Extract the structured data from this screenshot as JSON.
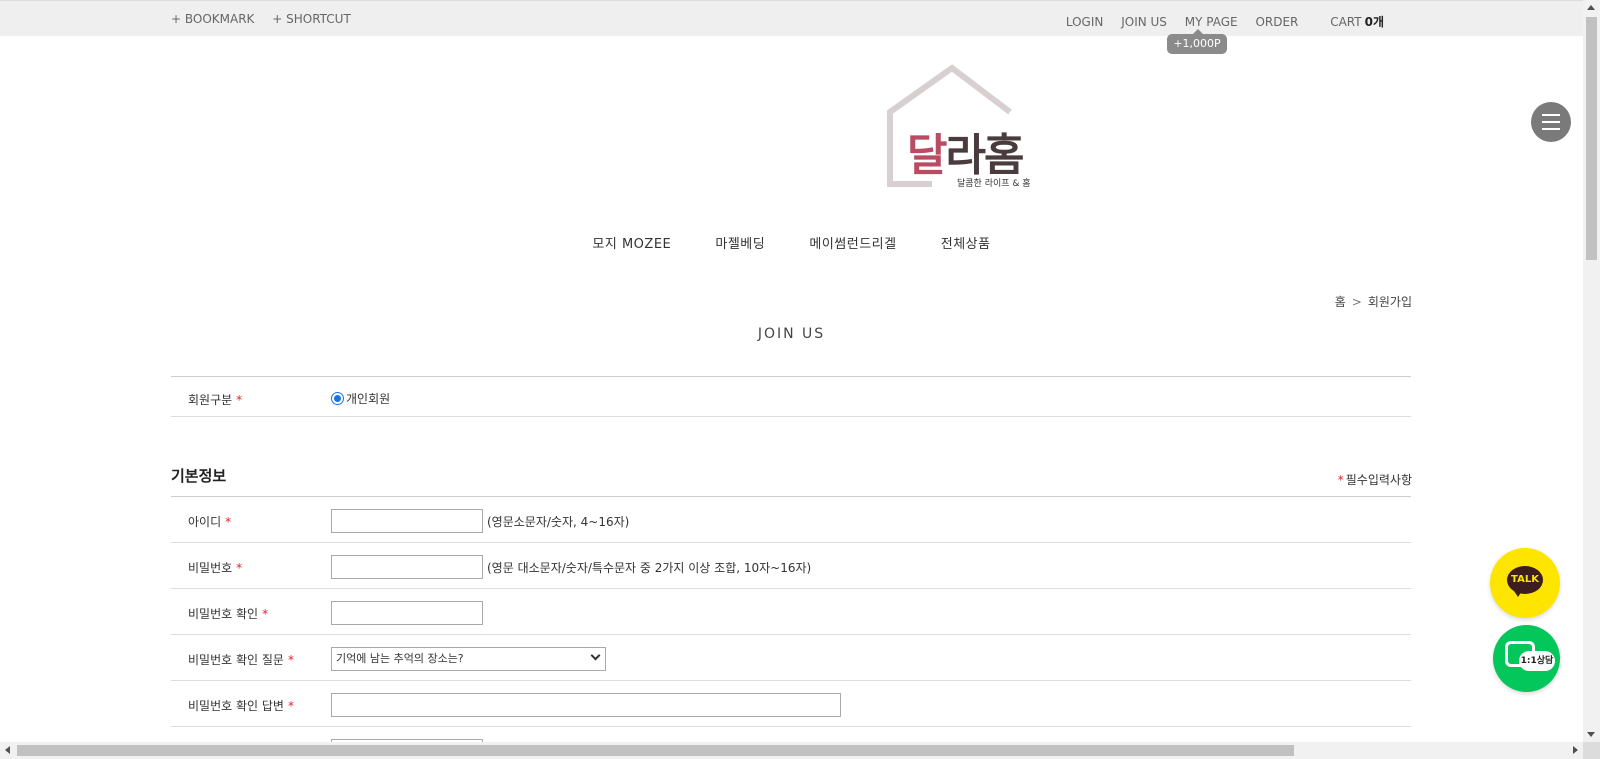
{
  "topbar": {
    "bookmark": "+ BOOKMARK",
    "shortcut": "+ SHORTCUT",
    "login": "LOGIN",
    "join": "JOIN US",
    "mypage": "MY PAGE",
    "order": "ORDER",
    "cart": "CART",
    "cart_count": "0개",
    "point_badge": "+1,000P"
  },
  "logo": {
    "main_accent": "달",
    "main_rest": "라홈",
    "sub": "달콤한 라이프 & 홈"
  },
  "gnb": [
    "모지 MOZEE",
    "마젤베딩",
    "메이썸런드리겔",
    "전체상품"
  ],
  "breadcrumb": {
    "home": "홈",
    "sep": ">",
    "current": "회원가입"
  },
  "page_title": "JOIN US",
  "member_type": {
    "label": "회원구분",
    "required": "*",
    "option": "개인회원"
  },
  "section": {
    "title": "기본정보",
    "required_star": "*",
    "required_note": "필수입력사항"
  },
  "fields": [
    {
      "label": "아이디",
      "required": "*",
      "hint": "(영문소문자/숫자, 4~16자)"
    },
    {
      "label": "비밀번호",
      "required": "*",
      "hint": "(영문 대소문자/숫자/특수문자 중 2가지 이상 조합, 10자~16자)"
    },
    {
      "label": "비밀번호 확인",
      "required": "*",
      "hint": ""
    },
    {
      "label": "비밀번호 확인 질문",
      "required": "*",
      "select_value": "기억에 남는 추억의 장소는?"
    },
    {
      "label": "비밀번호 확인 답변",
      "required": "*",
      "hint": ""
    }
  ],
  "floating": {
    "talk": "TALK",
    "chat": "1:1상담"
  },
  "colors": {
    "accent": "#b94b62",
    "required": "#e3232b",
    "kakao": "#fee500",
    "chat": "#03c75a"
  }
}
